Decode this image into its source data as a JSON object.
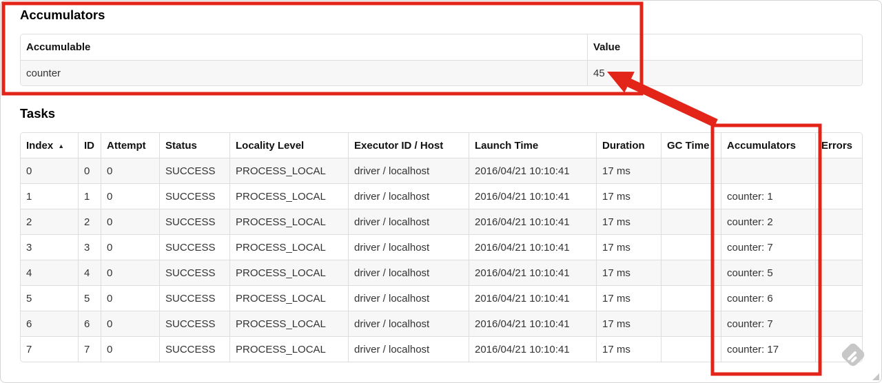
{
  "accumulators": {
    "heading": "Accumulators",
    "col_accumulable": "Accumulable",
    "col_value": "Value",
    "rows": [
      {
        "accumulable": "counter",
        "value": "45"
      }
    ]
  },
  "tasks": {
    "heading": "Tasks",
    "columns": [
      "Index",
      "ID",
      "Attempt",
      "Status",
      "Locality Level",
      "Executor ID / Host",
      "Launch Time",
      "Duration",
      "GC Time",
      "Accumulators",
      "Errors"
    ],
    "sort": {
      "column": "Index",
      "indicator": "▲",
      "direction": "ascending"
    },
    "rows": [
      {
        "index": "0",
        "id": "0",
        "attempt": "0",
        "status": "SUCCESS",
        "locality_level": "PROCESS_LOCAL",
        "executor_id_host": "driver / localhost",
        "launch_time": "2016/04/21 10:10:41",
        "duration": "17 ms",
        "gc_time": "",
        "accumulators": "",
        "errors": ""
      },
      {
        "index": "1",
        "id": "1",
        "attempt": "0",
        "status": "SUCCESS",
        "locality_level": "PROCESS_LOCAL",
        "executor_id_host": "driver / localhost",
        "launch_time": "2016/04/21 10:10:41",
        "duration": "17 ms",
        "gc_time": "",
        "accumulators": "counter: 1",
        "errors": ""
      },
      {
        "index": "2",
        "id": "2",
        "attempt": "0",
        "status": "SUCCESS",
        "locality_level": "PROCESS_LOCAL",
        "executor_id_host": "driver / localhost",
        "launch_time": "2016/04/21 10:10:41",
        "duration": "17 ms",
        "gc_time": "",
        "accumulators": "counter: 2",
        "errors": ""
      },
      {
        "index": "3",
        "id": "3",
        "attempt": "0",
        "status": "SUCCESS",
        "locality_level": "PROCESS_LOCAL",
        "executor_id_host": "driver / localhost",
        "launch_time": "2016/04/21 10:10:41",
        "duration": "17 ms",
        "gc_time": "",
        "accumulators": "counter: 7",
        "errors": ""
      },
      {
        "index": "4",
        "id": "4",
        "attempt": "0",
        "status": "SUCCESS",
        "locality_level": "PROCESS_LOCAL",
        "executor_id_host": "driver / localhost",
        "launch_time": "2016/04/21 10:10:41",
        "duration": "17 ms",
        "gc_time": "",
        "accumulators": "counter: 5",
        "errors": ""
      },
      {
        "index": "5",
        "id": "5",
        "attempt": "0",
        "status": "SUCCESS",
        "locality_level": "PROCESS_LOCAL",
        "executor_id_host": "driver / localhost",
        "launch_time": "2016/04/21 10:10:41",
        "duration": "17 ms",
        "gc_time": "",
        "accumulators": "counter: 6",
        "errors": ""
      },
      {
        "index": "6",
        "id": "6",
        "attempt": "0",
        "status": "SUCCESS",
        "locality_level": "PROCESS_LOCAL",
        "executor_id_host": "driver / localhost",
        "launch_time": "2016/04/21 10:10:41",
        "duration": "17 ms",
        "gc_time": "",
        "accumulators": "counter: 7",
        "errors": ""
      },
      {
        "index": "7",
        "id": "7",
        "attempt": "0",
        "status": "SUCCESS",
        "locality_level": "PROCESS_LOCAL",
        "executor_id_host": "driver / localhost",
        "launch_time": "2016/04/21 10:10:41",
        "duration": "17 ms",
        "gc_time": "",
        "accumulators": "counter: 17",
        "errors": ""
      }
    ]
  },
  "annotations": {
    "color": "#e32418"
  },
  "icons": {
    "sort_ascending": "▲",
    "watermark": "feedly-logo",
    "resize_grip": "resize-grip"
  }
}
